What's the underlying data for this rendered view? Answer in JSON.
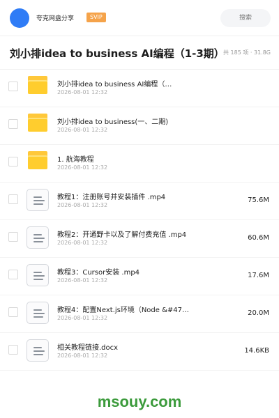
{
  "topbar": {
    "brand": "夸克网盘分享",
    "badge": "SVIP",
    "search_placeholder": "搜索"
  },
  "header": {
    "title": "刘小排idea to business AI编程（1-3期）",
    "meta": "共 185 项 · 31.8G"
  },
  "items": [
    {
      "type": "folder",
      "name": "刘小排idea to business AI编程（…",
      "date": "2026-08-01 12:32",
      "size": ""
    },
    {
      "type": "folder",
      "name": "刘小排idea to business(一、二期)",
      "date": "2026-08-01 12:32",
      "size": ""
    },
    {
      "type": "folder",
      "name": "1. 航海教程",
      "date": "2026-08-01 12:32",
      "size": ""
    },
    {
      "type": "file",
      "name": "教程1：注册账号并安装插件 .mp4",
      "date": "2026-08-01 12:32",
      "size": "75.6M"
    },
    {
      "type": "file",
      "name": "教程2：开通野卡以及了解付费充值 .mp4",
      "date": "2026-08-01 12:32",
      "size": "60.6M"
    },
    {
      "type": "file",
      "name": "教程3：Cursor安装 .mp4",
      "date": "2026-08-01 12:32",
      "size": "17.6M"
    },
    {
      "type": "file",
      "name": "教程4：配置Next.js环境（Node &#47…",
      "date": "2026-08-01 12:32",
      "size": "20.0M"
    },
    {
      "type": "file",
      "name": "相关教程链接.docx",
      "date": "2026-08-01 12:32",
      "size": "14.6KB"
    }
  ],
  "footer": {
    "watermark": "msouy.com"
  },
  "colors": {
    "avatar": "#2f7cf6",
    "badge": "#f5a34a",
    "folder": "#ffcd2e",
    "watermark": "#3c9b3c"
  }
}
